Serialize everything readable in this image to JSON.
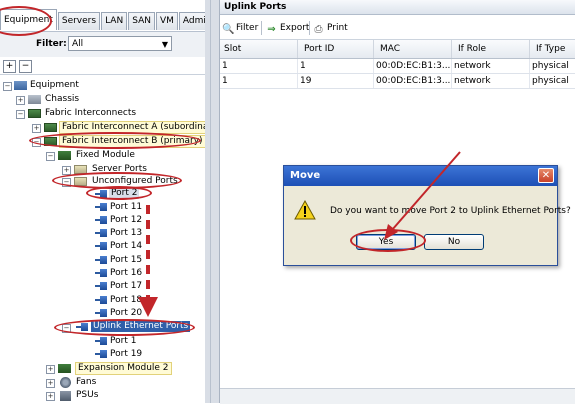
{
  "left_panel": {
    "tabs": [
      "Equipment",
      "Servers",
      "LAN",
      "SAN",
      "VM",
      "Admin"
    ],
    "filter_label": "Filter:",
    "filter_value": "All",
    "tree": {
      "equipment": "Equipment",
      "chassis": "Chassis",
      "fabric_interconnects": "Fabric Interconnects",
      "fi_a": "Fabric Interconnect A (subordinate",
      "fi_b": "Fabric Interconnect B (primary)",
      "fixed_module": "Fixed Module",
      "server_ports": "Server Ports",
      "unconfigured_ports": "Unconfigured Ports",
      "unconfigured_port_list": [
        "Port 2",
        "Port 11",
        "Port 12",
        "Port 13",
        "Port 14",
        "Port 15",
        "Port 16",
        "Port 17",
        "Port 18",
        "Port 20"
      ],
      "uplink_ethernet_ports": "Uplink Ethernet Ports",
      "uplink_port_list": [
        "Port 1",
        "Port 19"
      ],
      "expansion_module": "Expansion Module 2",
      "fans": "Fans",
      "psus": "PSUs"
    }
  },
  "right_panel": {
    "title": "Uplink Ports",
    "toolbar": {
      "filter": "Filter",
      "export": "Export",
      "print": "Print"
    },
    "columns": [
      "Slot",
      "Port ID",
      "MAC",
      "If Role",
      "If Type"
    ],
    "rows": [
      [
        "1",
        "1",
        "00:0D:EC:B1:3...",
        "network",
        "physical"
      ],
      [
        "1",
        "19",
        "00:0D:EC:B1:3...",
        "network",
        "physical"
      ]
    ]
  },
  "dialog": {
    "title": "Move",
    "message": "Do you want to move Port 2 to Uplink Ethernet Ports?",
    "yes_label": "Yes",
    "no_label": "No"
  },
  "colors": {
    "annotation_red": "#c2262a",
    "selection_blue": "#2f5fa9",
    "dialog_title_blue": "#1d4fb5"
  }
}
